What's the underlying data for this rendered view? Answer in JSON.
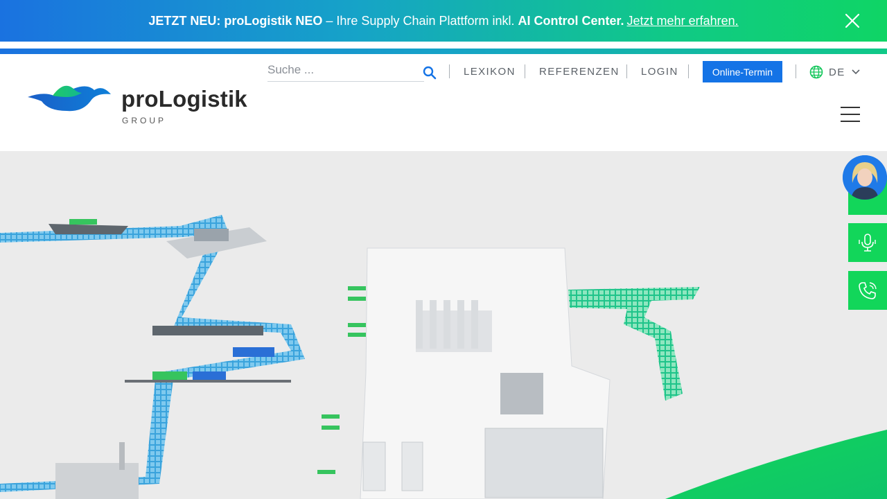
{
  "banner": {
    "lead": "JETZT NEU:",
    "product": "proLogistik NEO",
    "middle": "– Ihre Supply Chain Plattform inkl.",
    "highlight": "AI Control Center.",
    "link": "Jetzt mehr erfahren."
  },
  "logo": {
    "brand": "proLogistik",
    "group": "GROUP"
  },
  "search": {
    "placeholder": "Suche ..."
  },
  "nav": {
    "lexikon": "LEXIKON",
    "referenzen": "REFERENZEN",
    "login": "LOGIN"
  },
  "cta": {
    "termin": "Online-Termin"
  },
  "lang": {
    "current": "DE"
  },
  "colors": {
    "primary_blue": "#1473e6",
    "accent_green": "#12d65a",
    "text_gray": "#5b6168"
  },
  "icons": [
    "close-icon",
    "search-icon",
    "globe-icon",
    "chevron-down-icon",
    "menu-icon",
    "microphone-icon",
    "phone-icon",
    "assistant-avatar"
  ]
}
